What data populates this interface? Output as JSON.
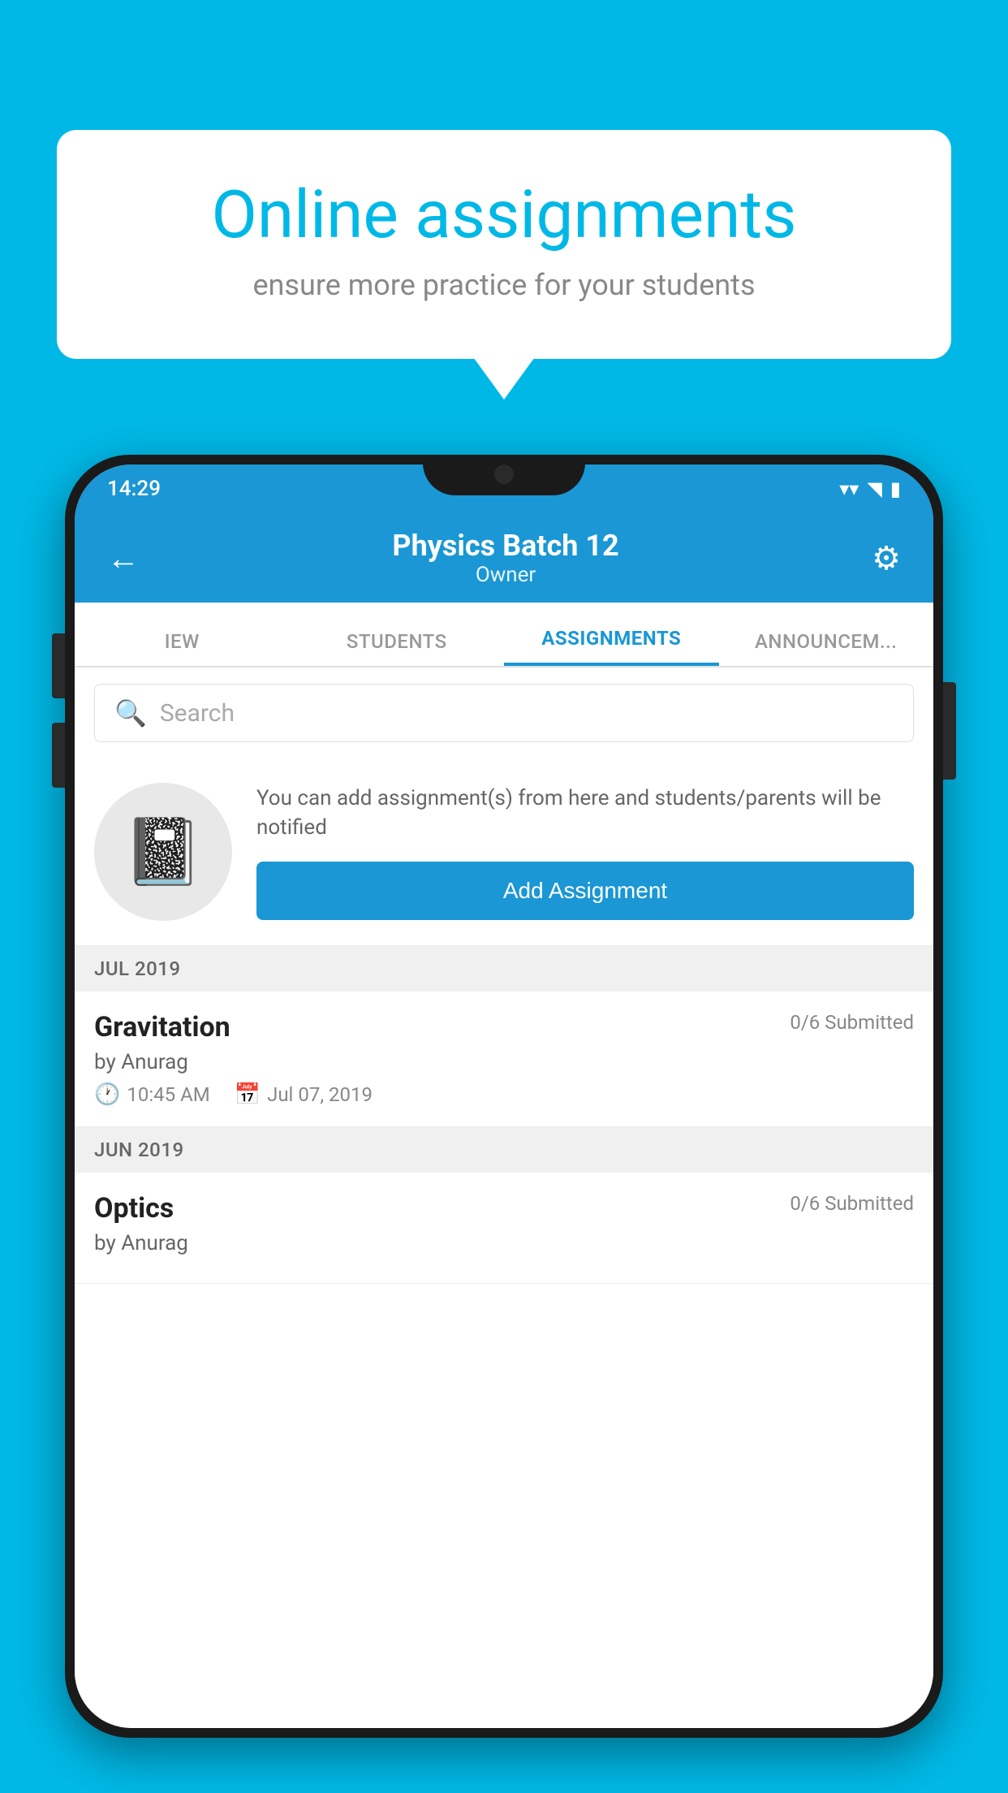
{
  "background_color": "#00b8e6",
  "speech_bubble": {
    "title": "Online assignments",
    "subtitle": "ensure more practice for your students"
  },
  "status_bar": {
    "time": "14:29",
    "wifi": "▲",
    "signal": "▲",
    "battery": "▮"
  },
  "app_header": {
    "title": "Physics Batch 12",
    "subtitle": "Owner",
    "back_label": "←",
    "settings_label": "⚙"
  },
  "tabs": [
    {
      "label": "IEW",
      "active": false
    },
    {
      "label": "STUDENTS",
      "active": false
    },
    {
      "label": "ASSIGNMENTS",
      "active": true
    },
    {
      "label": "ANNOUNCEM...",
      "active": false
    }
  ],
  "search": {
    "placeholder": "Search"
  },
  "promo": {
    "description": "You can add assignment(s) from here and students/parents will be notified",
    "button_label": "Add Assignment"
  },
  "month_sections": [
    {
      "month": "JUL 2019",
      "assignments": [
        {
          "title": "Gravitation",
          "submitted": "0/6 Submitted",
          "author": "by Anurag",
          "time": "10:45 AM",
          "date": "Jul 07, 2019"
        }
      ]
    },
    {
      "month": "JUN 2019",
      "assignments": [
        {
          "title": "Optics",
          "submitted": "0/6 Submitted",
          "author": "by Anurag",
          "time": "",
          "date": ""
        }
      ]
    }
  ]
}
